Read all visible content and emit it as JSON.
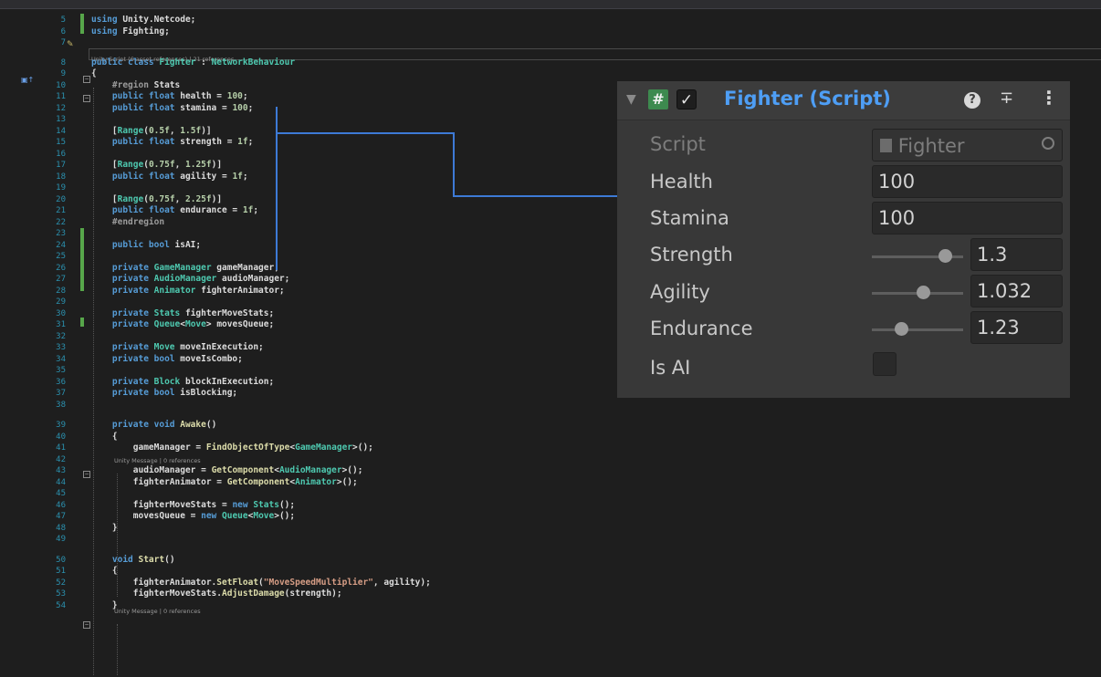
{
  "code_lines": [
    {
      "n": "5",
      "code": [
        [
          "kw",
          "using "
        ],
        [
          "",
          "Unity.Netcode;"
        ]
      ]
    },
    {
      "n": "6",
      "code": [
        [
          "kw",
          "using "
        ],
        [
          "",
          "Fighting;"
        ]
      ]
    },
    {
      "n": "7",
      "code": []
    },
    {
      "n": "8",
      "code": [
        [
          "kw",
          "public class "
        ],
        [
          "ty",
          "Fighter"
        ],
        [
          "",
          " : "
        ],
        [
          "ty",
          "NetworkBehaviour"
        ]
      ]
    },
    {
      "n": "9",
      "code": [
        [
          "",
          "{"
        ]
      ]
    },
    {
      "n": "10",
      "code": [
        [
          "pp",
          "    #region "
        ],
        [
          "",
          "Stats"
        ]
      ]
    },
    {
      "n": "11",
      "code": [
        [
          "kw",
          "    public float "
        ],
        [
          "",
          "health = "
        ],
        [
          "num",
          "100"
        ],
        [
          "",
          ";"
        ]
      ]
    },
    {
      "n": "12",
      "code": [
        [
          "kw",
          "    public float "
        ],
        [
          "",
          "stamina = "
        ],
        [
          "num",
          "100"
        ],
        [
          "",
          ";"
        ]
      ]
    },
    {
      "n": "13",
      "code": []
    },
    {
      "n": "14",
      "code": [
        [
          "",
          "    ["
        ],
        [
          "ty",
          "Range"
        ],
        [
          "",
          "("
        ],
        [
          "num",
          "0.5f"
        ],
        [
          "",
          ", "
        ],
        [
          "num",
          "1.5f"
        ],
        [
          "",
          ")]"
        ]
      ]
    },
    {
      "n": "15",
      "code": [
        [
          "kw",
          "    public float "
        ],
        [
          "",
          "strength = "
        ],
        [
          "num",
          "1f"
        ],
        [
          "",
          ";"
        ]
      ]
    },
    {
      "n": "16",
      "code": []
    },
    {
      "n": "17",
      "code": [
        [
          "",
          "    ["
        ],
        [
          "ty",
          "Range"
        ],
        [
          "",
          "("
        ],
        [
          "num",
          "0.75f"
        ],
        [
          "",
          ", "
        ],
        [
          "num",
          "1.25f"
        ],
        [
          "",
          ")]"
        ]
      ]
    },
    {
      "n": "18",
      "code": [
        [
          "kw",
          "    public float "
        ],
        [
          "",
          "agility = "
        ],
        [
          "num",
          "1f"
        ],
        [
          "",
          ";"
        ]
      ]
    },
    {
      "n": "19",
      "code": []
    },
    {
      "n": "20",
      "code": [
        [
          "",
          "    ["
        ],
        [
          "ty",
          "Range"
        ],
        [
          "",
          "("
        ],
        [
          "num",
          "0.75f"
        ],
        [
          "",
          ", "
        ],
        [
          "num",
          "2.25f"
        ],
        [
          "",
          ")]"
        ]
      ]
    },
    {
      "n": "21",
      "code": [
        [
          "kw",
          "    public float "
        ],
        [
          "",
          "endurance = "
        ],
        [
          "num",
          "1f"
        ],
        [
          "",
          ";"
        ]
      ]
    },
    {
      "n": "22",
      "code": [
        [
          "pp",
          "    #endregion"
        ]
      ]
    },
    {
      "n": "23",
      "code": []
    },
    {
      "n": "24",
      "code": [
        [
          "kw",
          "    public bool "
        ],
        [
          "",
          "isAI;"
        ]
      ]
    },
    {
      "n": "25",
      "code": []
    },
    {
      "n": "26",
      "code": [
        [
          "kw",
          "    private "
        ],
        [
          "ty",
          "GameManager"
        ],
        [
          "",
          " gameManager;"
        ]
      ]
    },
    {
      "n": "27",
      "code": [
        [
          "kw",
          "    private "
        ],
        [
          "ty",
          "AudioManager"
        ],
        [
          "",
          " audioManager;"
        ]
      ]
    },
    {
      "n": "28",
      "code": [
        [
          "kw",
          "    private "
        ],
        [
          "ty",
          "Animator"
        ],
        [
          "",
          " fighterAnimator;"
        ]
      ]
    },
    {
      "n": "29",
      "code": []
    },
    {
      "n": "30",
      "code": [
        [
          "kw",
          "    private "
        ],
        [
          "ty",
          "Stats"
        ],
        [
          "",
          " fighterMoveStats;"
        ]
      ]
    },
    {
      "n": "31",
      "code": [
        [
          "kw",
          "    private "
        ],
        [
          "ty",
          "Queue"
        ],
        [
          "",
          "<"
        ],
        [
          "ty",
          "Move"
        ],
        [
          "",
          "> movesQueue;"
        ]
      ]
    },
    {
      "n": "32",
      "code": []
    },
    {
      "n": "33",
      "code": [
        [
          "kw",
          "    private "
        ],
        [
          "ty",
          "Move"
        ],
        [
          "",
          " moveInExecution;"
        ]
      ]
    },
    {
      "n": "34",
      "code": [
        [
          "kw",
          "    private bool "
        ],
        [
          "",
          "moveIsCombo;"
        ]
      ]
    },
    {
      "n": "35",
      "code": []
    },
    {
      "n": "36",
      "code": [
        [
          "kw",
          "    private "
        ],
        [
          "ty",
          "Block"
        ],
        [
          "",
          " blockInExecution;"
        ]
      ]
    },
    {
      "n": "37",
      "code": [
        [
          "kw",
          "    private bool "
        ],
        [
          "",
          "isBlocking;"
        ]
      ]
    },
    {
      "n": "38",
      "code": []
    },
    {
      "n": "39",
      "code": [
        [
          "kw",
          "    private void "
        ],
        [
          "fn",
          "Awake"
        ],
        [
          "",
          "()"
        ]
      ]
    },
    {
      "n": "40",
      "code": [
        [
          "",
          "    {"
        ]
      ]
    },
    {
      "n": "41",
      "code": [
        [
          "",
          "        gameManager = "
        ],
        [
          "fn",
          "FindObjectOfType"
        ],
        [
          "",
          "<"
        ],
        [
          "ty",
          "GameManager"
        ],
        [
          "",
          ">();"
        ]
      ]
    },
    {
      "n": "42",
      "code": []
    },
    {
      "n": "43",
      "code": [
        [
          "",
          "        audioManager = "
        ],
        [
          "fn",
          "GetComponent"
        ],
        [
          "",
          "<"
        ],
        [
          "ty",
          "AudioManager"
        ],
        [
          "",
          ">();"
        ]
      ]
    },
    {
      "n": "44",
      "code": [
        [
          "",
          "        fighterAnimator = "
        ],
        [
          "fn",
          "GetComponent"
        ],
        [
          "",
          "<"
        ],
        [
          "ty",
          "Animator"
        ],
        [
          "",
          ">();"
        ]
      ]
    },
    {
      "n": "45",
      "code": []
    },
    {
      "n": "46",
      "code": [
        [
          "",
          "        fighterMoveStats = "
        ],
        [
          "kw",
          "new "
        ],
        [
          "ty",
          "Stats"
        ],
        [
          "",
          "();"
        ]
      ]
    },
    {
      "n": "47",
      "code": [
        [
          "",
          "        movesQueue = "
        ],
        [
          "kw",
          "new "
        ],
        [
          "ty",
          "Queue"
        ],
        [
          "",
          "<"
        ],
        [
          "ty",
          "Move"
        ],
        [
          "",
          ">();"
        ]
      ]
    },
    {
      "n": "48",
      "code": [
        [
          "",
          "    }"
        ]
      ]
    },
    {
      "n": "49",
      "code": []
    },
    {
      "n": "50",
      "code": [
        [
          "kw",
          "    void "
        ],
        [
          "fn",
          "Start"
        ],
        [
          "",
          "()"
        ]
      ]
    },
    {
      "n": "51",
      "code": [
        [
          "",
          "    {"
        ]
      ]
    },
    {
      "n": "52",
      "code": [
        [
          "",
          "        fighterAnimator."
        ],
        [
          "fn",
          "SetFloat"
        ],
        [
          "",
          "("
        ],
        [
          "str",
          "\"MoveSpeedMultiplier\""
        ],
        [
          "",
          ", agility);"
        ]
      ]
    },
    {
      "n": "53",
      "code": [
        [
          "",
          "        fighterMoveStats."
        ],
        [
          "fn",
          "AdjustDamage"
        ],
        [
          "",
          "(strength);"
        ]
      ]
    },
    {
      "n": "54",
      "code": [
        [
          "",
          "    }"
        ]
      ]
    }
  ],
  "codelens": {
    "class_lens": "Unity Script (6 asset references) | 21 references",
    "awake_lens": "Unity Message | 0 references",
    "start_lens": "Unity Message | 0 references"
  },
  "inspector": {
    "component_title": "Fighter (Script)",
    "enabled": true,
    "header_icons": [
      "help-icon",
      "presets-icon",
      "more-options-icon"
    ],
    "script_label": "Script",
    "script_value": "Fighter",
    "fields": {
      "health": {
        "label": "Health",
        "value": "100"
      },
      "stamina": {
        "label": "Stamina",
        "value": "100"
      },
      "strength": {
        "label": "Strength",
        "value": "1.3",
        "min": 0.5,
        "max": 1.5
      },
      "agility": {
        "label": "Agility",
        "value": "1.032",
        "min": 0.75,
        "max": 1.25
      },
      "endurance": {
        "label": "Endurance",
        "value": "1.23",
        "min": 0.75,
        "max": 2.25
      },
      "is_ai": {
        "label": "Is AI",
        "checked": false
      }
    }
  },
  "colors": {
    "arrow": "#3d7ad6",
    "title": "#4e9ef5",
    "change_bar": "#57a64a"
  }
}
